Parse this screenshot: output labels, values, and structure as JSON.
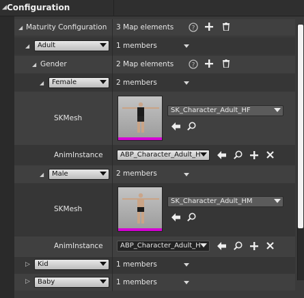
{
  "panel": {
    "title": "Configuration"
  },
  "rows": {
    "maturity": {
      "label": "Maturity Configuration",
      "value": "3 Map elements"
    },
    "adult": {
      "key": "Adult",
      "value": "1 members"
    },
    "gender": {
      "label": "Gender",
      "value": "2 Map elements"
    },
    "female": {
      "key": "Female",
      "value": "2 members"
    },
    "female_skmesh": {
      "label": "SKMesh",
      "asset": "SK_Character_Adult_HF"
    },
    "female_anim": {
      "label": "AnimInstance",
      "value": "ABP_Character_Adult_H"
    },
    "male": {
      "key": "Male",
      "value": "2 members"
    },
    "male_skmesh": {
      "label": "SKMesh",
      "asset": "SK_Character_Adult_HM"
    },
    "male_anim": {
      "label": "AnimInstance",
      "value": "ABP_Character_Adult_H"
    },
    "kid": {
      "key": "Kid",
      "value": "1 members"
    },
    "baby": {
      "key": "Baby",
      "value": "1 members"
    }
  },
  "colors": {
    "panel_bg": "#3a3a3a",
    "thumbnail_stripe": "#d400d4"
  },
  "icons": [
    "collapse-arrow-icon",
    "help-icon",
    "add-icon",
    "trash-icon",
    "back-arrow-icon",
    "browse-icon",
    "clear-icon"
  ]
}
